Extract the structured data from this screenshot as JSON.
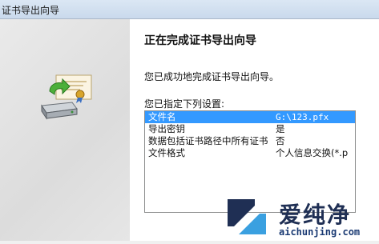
{
  "window": {
    "title": "证书导出向导"
  },
  "wizard": {
    "heading": "正在完成证书导出向导",
    "message": "您已成功地完成证书导出向导。",
    "settings_label": "您已指定下列设置:"
  },
  "settings": {
    "rows": [
      {
        "name": "文件名",
        "value": "G:\\123.pfx"
      },
      {
        "name": "导出密钥",
        "value": "是"
      },
      {
        "name": "数据包括证书路径中所有证书",
        "value": "否"
      },
      {
        "name": "文件格式",
        "value": "个人信息交换(*.p"
      }
    ]
  },
  "watermark": {
    "brand": "爱纯净",
    "url": "aichunjing.com"
  },
  "colors": {
    "selection": "#3399ff",
    "brand": "#1f2f54"
  }
}
